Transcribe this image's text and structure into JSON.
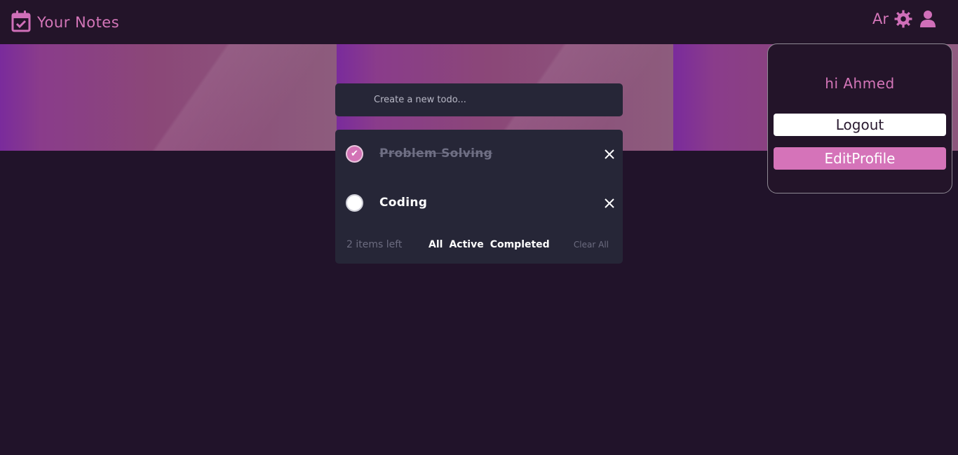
{
  "header": {
    "title": "Your Notes",
    "language": "Ar"
  },
  "todo": {
    "placeholder": "Create a new todo...",
    "items": [
      {
        "label": "Problem Solving",
        "completed": true
      },
      {
        "label": "Coding",
        "completed": false
      }
    ],
    "items_left": "2 items left",
    "filters": [
      "All",
      "Active",
      "Completed"
    ],
    "clear_label": "Clear All"
  },
  "profile": {
    "greeting": "hi Ahmed",
    "logout_label": "Logout",
    "edit_label": "EditProfile"
  },
  "colors": {
    "background": "#21132a",
    "accent": "#d476b9",
    "card": "#262637"
  },
  "icons": {
    "brand": "calendar-check-icon",
    "settings": "gear-icon",
    "user": "user-icon",
    "delete": "close-icon",
    "check": "checkmark-icon"
  }
}
